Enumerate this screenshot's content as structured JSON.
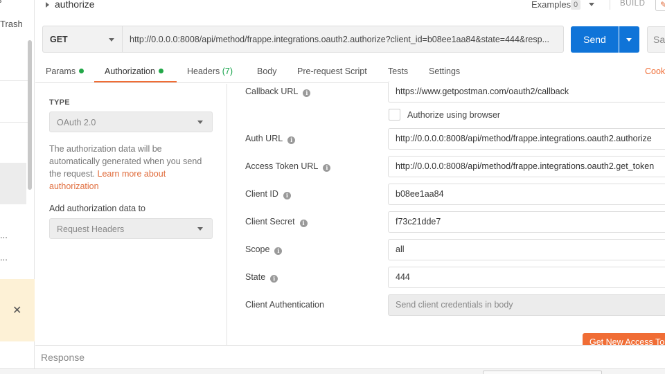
{
  "sidebar": {
    "partial_top": "s",
    "trash_label": "Trash",
    "ellipsis_1": "...",
    "ellipsis_2": "..."
  },
  "request": {
    "name": "authorize",
    "examples_label": "Examples",
    "examples_count": "0",
    "build_label": "BUILD",
    "method": "GET",
    "url": "http://0.0.0.0:8008/api/method/frappe.integrations.oauth2.authorize?client_id=b08ee1aa84&state=444&resp...",
    "send_label": "Send",
    "save_label": "Sav"
  },
  "tabs": [
    {
      "label": "Params"
    },
    {
      "label": "Authorization"
    },
    {
      "label": "Headers",
      "count": "(7)"
    },
    {
      "label": "Body"
    },
    {
      "label": "Pre-request Script"
    },
    {
      "label": "Tests"
    },
    {
      "label": "Settings"
    }
  ],
  "cookies_label": "Cook",
  "auth": {
    "type_label": "TYPE",
    "type_value": "OAuth 2.0",
    "desc_text": "The authorization data will be automatically generated when you send the request. ",
    "desc_link": "Learn more about authorization",
    "add_to_label": "Add authorization data to",
    "add_to_value": "Request Headers"
  },
  "form": {
    "callback_url": {
      "label": "Callback URL",
      "value": "https://www.getpostman.com/oauth2/callback"
    },
    "authorize_browser": {
      "label": "Authorize using browser",
      "checked": false
    },
    "auth_url": {
      "label": "Auth URL",
      "value": "http://0.0.0.0:8008/api/method/frappe.integrations.oauth2.authorize"
    },
    "access_token_url": {
      "label": "Access Token URL",
      "value": "http://0.0.0.0:8008/api/method/frappe.integrations.oauth2.get_token"
    },
    "client_id": {
      "label": "Client ID",
      "value": "b08ee1aa84"
    },
    "client_secret": {
      "label": "Client Secret",
      "value": "f73c21dde7"
    },
    "scope": {
      "label": "Scope",
      "value": "all"
    },
    "state": {
      "label": "State",
      "value": "444"
    },
    "client_auth": {
      "label": "Client Authentication",
      "value": "Send client credentials in body"
    },
    "get_new_token_label": "Get New Access Tok"
  },
  "response": {
    "label": "Response"
  },
  "colors": {
    "accent": "#f06d35",
    "send": "#0f74d8",
    "dot": "#22a748"
  }
}
